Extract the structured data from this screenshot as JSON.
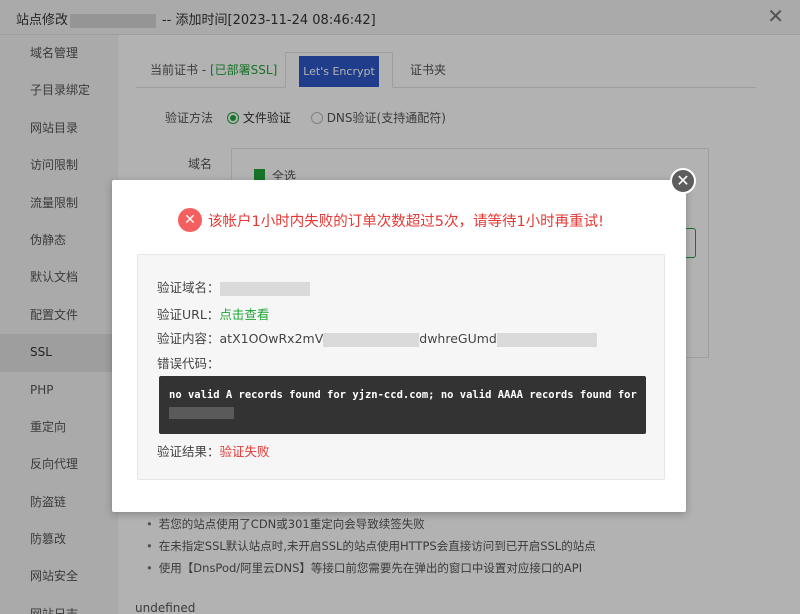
{
  "window": {
    "title_prefix": "站点修改",
    "title_suffix": "-- 添加时间[2023-11-24 08:46:42]",
    "close_glyph": "✕"
  },
  "sidebar": {
    "items": [
      {
        "label": "域名管理"
      },
      {
        "label": "子目录绑定"
      },
      {
        "label": "网站目录"
      },
      {
        "label": "访问限制"
      },
      {
        "label": "流量限制"
      },
      {
        "label": "伪静态"
      },
      {
        "label": "默认文档"
      },
      {
        "label": "配置文件"
      },
      {
        "label": "SSL"
      },
      {
        "label": "PHP"
      },
      {
        "label": "重定向"
      },
      {
        "label": "反向代理"
      },
      {
        "label": "防盗链"
      },
      {
        "label": "防篡改"
      },
      {
        "label": "网站安全"
      },
      {
        "label": "网站日志"
      }
    ]
  },
  "tabs": {
    "current_cert_prefix": "当前证书 - ",
    "current_cert_status": "[已部署SSL]",
    "letsencrypt": "Let's Encrypt",
    "cert_folder": "证书夹"
  },
  "verify": {
    "label": "验证方法",
    "option_file": "文件验证",
    "option_dns": "DNS验证(支持通配符)"
  },
  "domain": {
    "label": "域名",
    "select_all": "全选"
  },
  "notes": [
    "若您的站点使用了CDN或301重定向会导致续签失败",
    "在未指定SSL默认站点时,未开启SSL的站点使用HTTPS会直接访问到已开启SSL的站点",
    "使用【DnsPod/阿里云DNS】等接口前您需要先在弹出的窗口中设置对应接口的API"
  ],
  "undefined_text": "undefined",
  "modal": {
    "close_glyph": "✕",
    "error_icon_glyph": "✕",
    "error_message": "该帐户1小时内失败的订单次数超过5次，请等待1小时再重试!",
    "verify_domain_label": "验证域名：",
    "verify_url_label": "验证URL：",
    "verify_url_link": "点击查看",
    "verify_content_label": "验证内容：",
    "verify_content_part1": "atX1OOwRx2mV",
    "verify_content_part2": "dwhreGUmd",
    "error_code_label": "错误代码：",
    "error_code_text": "no valid A records found for yjzn-ccd.com; no valid AAAA records found for",
    "verify_result_label": "验证结果：",
    "verify_result_value": "验证失败"
  },
  "colors": {
    "accent_green": "#20a53a",
    "error_red": "#e53935",
    "tab_active_bg": "#2f58c7"
  }
}
